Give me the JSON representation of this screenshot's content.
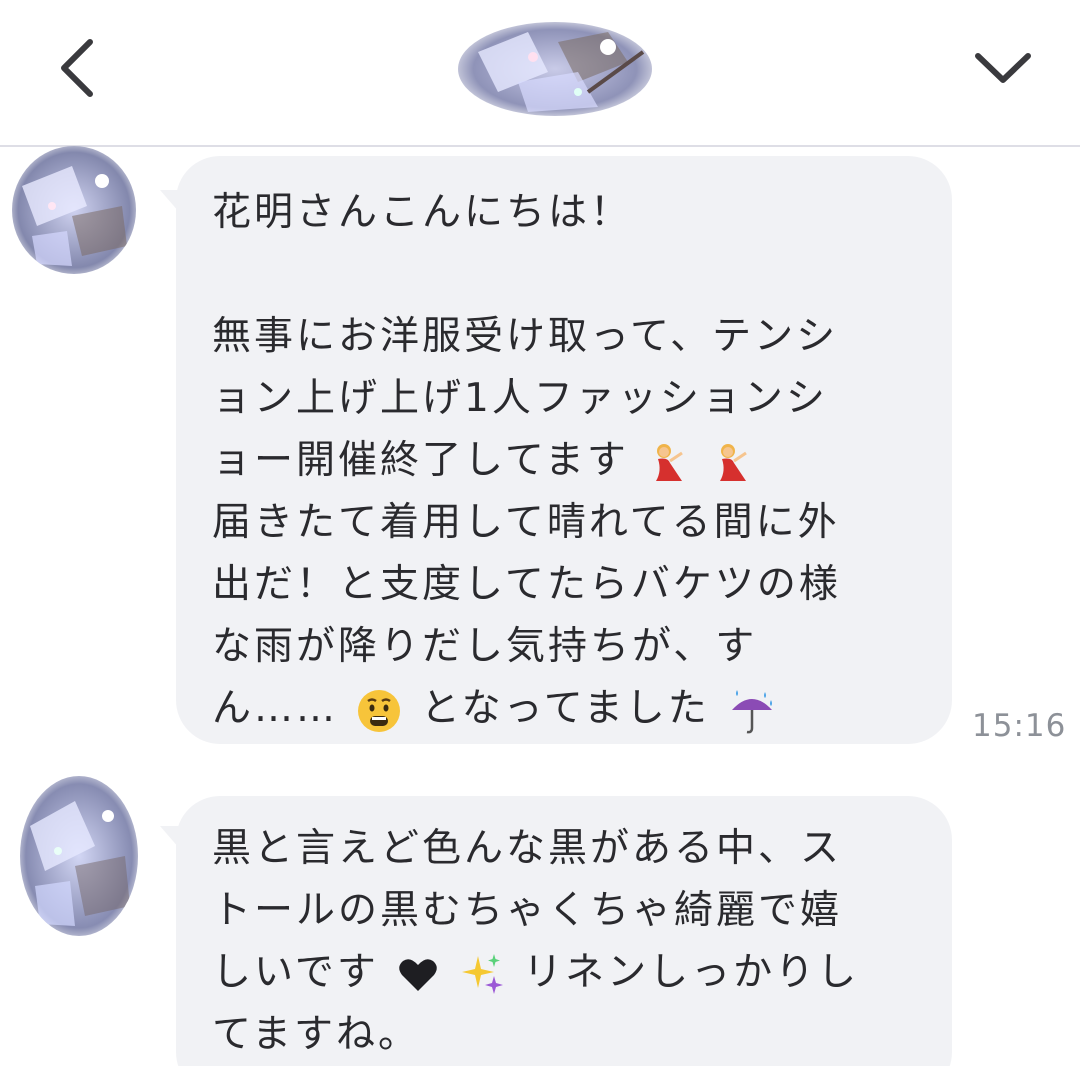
{
  "header": {
    "back_icon": "chevron-left-icon",
    "expand_icon": "chevron-down-icon",
    "avatar": "contact-avatar-glitter"
  },
  "messages": [
    {
      "lines": [
        "花明さんこんにちは！",
        "",
        "無事にお洋服受け取って、テンシ",
        "ョン上げ上げ1人ファッションシ",
        "ョー開催終了してます",
        "届きたて着用して晴れてる間に外",
        "出だ！と支度してたらバケツの様",
        "な雨が降りだし気持ちが、す",
        "ん……",
        "となってました"
      ],
      "emojis": [
        "dancer-emoji",
        "dancer-emoji",
        "anguished-face-emoji",
        "umbrella-rain-emoji"
      ],
      "time": "15:16"
    },
    {
      "lines": [
        "黒と言えど色んな黒がある中、ス",
        "トールの黒むちゃくちゃ綺麗で嬉",
        "しいです",
        "リネンしっかりし",
        "てますね。"
      ],
      "emojis": [
        "black-heart-emoji",
        "sparkles-emoji"
      ]
    }
  ],
  "colors": {
    "bubble": "#f1f2f5",
    "text": "#2a2a2e",
    "timestamp": "#8d9198",
    "divider": "#dedee6"
  }
}
